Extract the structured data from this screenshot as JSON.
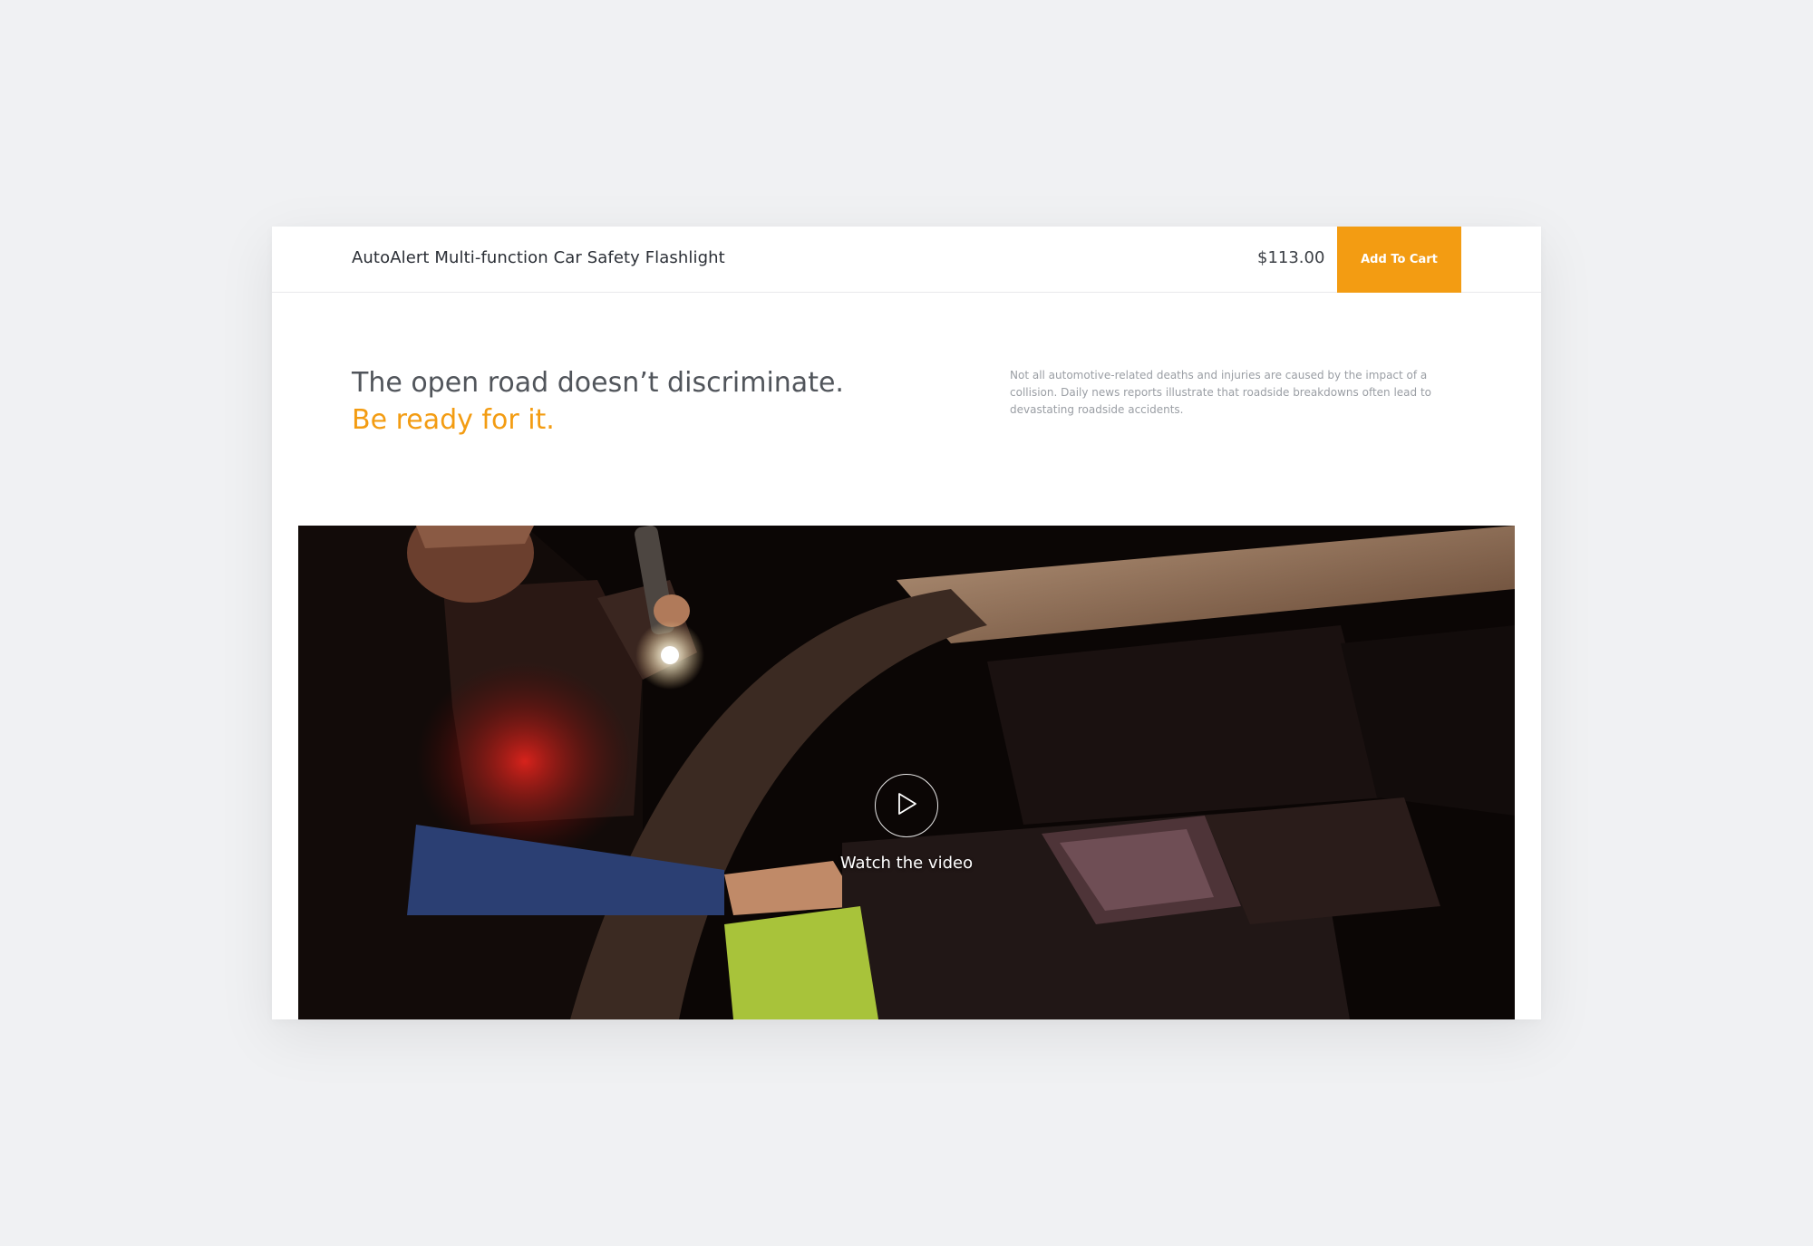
{
  "header": {
    "product_title": "AutoAlert Multi-function Car Safety Flashlight",
    "price": "$113.00",
    "add_to_cart_label": "Add To Cart"
  },
  "hero": {
    "headline": "The open road doesn’t discriminate.",
    "headline_accent": "Be ready for it.",
    "description": "Not all automotive-related deaths and injuries are caused by the impact of a collision. Daily news reports illustrate that roadside breakdowns often lead to devastating roadside accidents."
  },
  "video": {
    "watch_label": "Watch the video",
    "play_icon": "play-icon"
  },
  "colors": {
    "accent": "#f39c12",
    "page_background": "#f0f1f3",
    "card_background": "#ffffff"
  }
}
